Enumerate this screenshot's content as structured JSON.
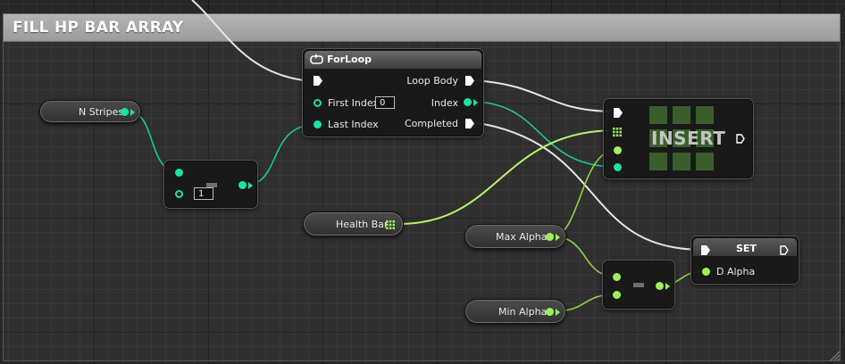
{
  "comment": {
    "title": "FILL HP BAR ARRAY"
  },
  "variables": {
    "n_stripes": "N Stripes",
    "health_bar": "Health Bar",
    "max_alpha": "Max Alpha",
    "min_alpha": "Min Alpha"
  },
  "add_node": {
    "operator": "+",
    "value": "1"
  },
  "forloop": {
    "title": "ForLoop",
    "first_index_label": "First Index",
    "first_index_value": "0",
    "last_index_label": "Last Index",
    "loop_body_label": "Loop Body",
    "index_label": "Index",
    "completed_label": "Completed"
  },
  "insert": {
    "title": "INSERT"
  },
  "subtract_node": {
    "operator": "-"
  },
  "set_node": {
    "title": "SET",
    "pin_label": "D Alpha"
  },
  "colors": {
    "exec": "#ffffff",
    "integer": "#1ee0a8",
    "float": "#a0f05a",
    "array": "#a0f05a"
  }
}
